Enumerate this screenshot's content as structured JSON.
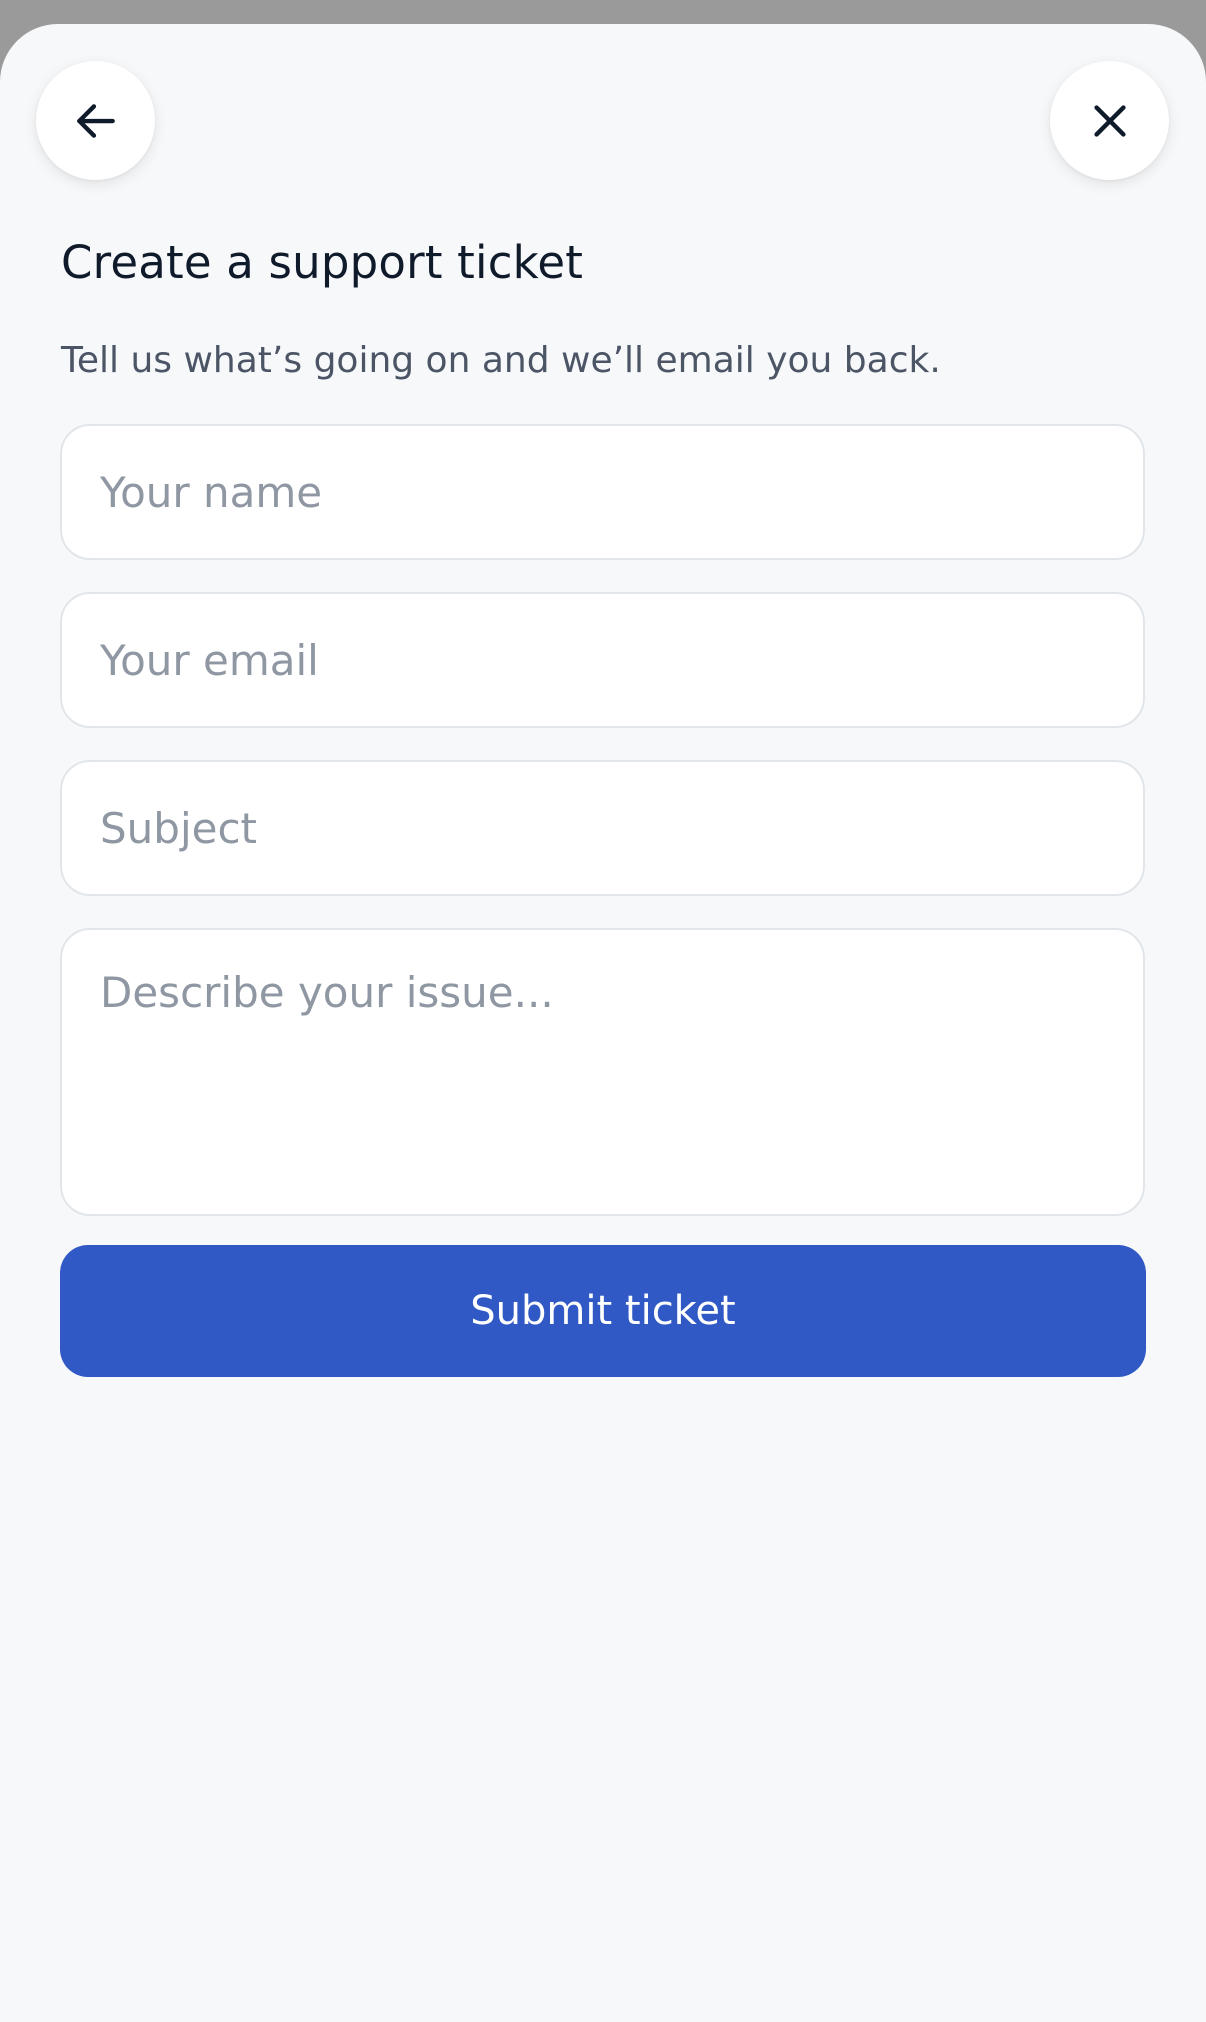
{
  "header": {
    "back_icon": "arrow-left-icon",
    "close_icon": "close-icon"
  },
  "form": {
    "title": "Create a support ticket",
    "subtitle": "Tell us what’s going on and we’ll email you back.",
    "name": {
      "value": "",
      "placeholder": "Your name"
    },
    "email": {
      "value": "",
      "placeholder": "Your email"
    },
    "subject": {
      "value": "",
      "placeholder": "Subject"
    },
    "description": {
      "value": "",
      "placeholder": "Describe your issue..."
    },
    "submit_label": "Submit ticket"
  },
  "colors": {
    "accent": "#3059c6",
    "background": "#f7f8fa",
    "overlay": "#9a9a9a"
  }
}
